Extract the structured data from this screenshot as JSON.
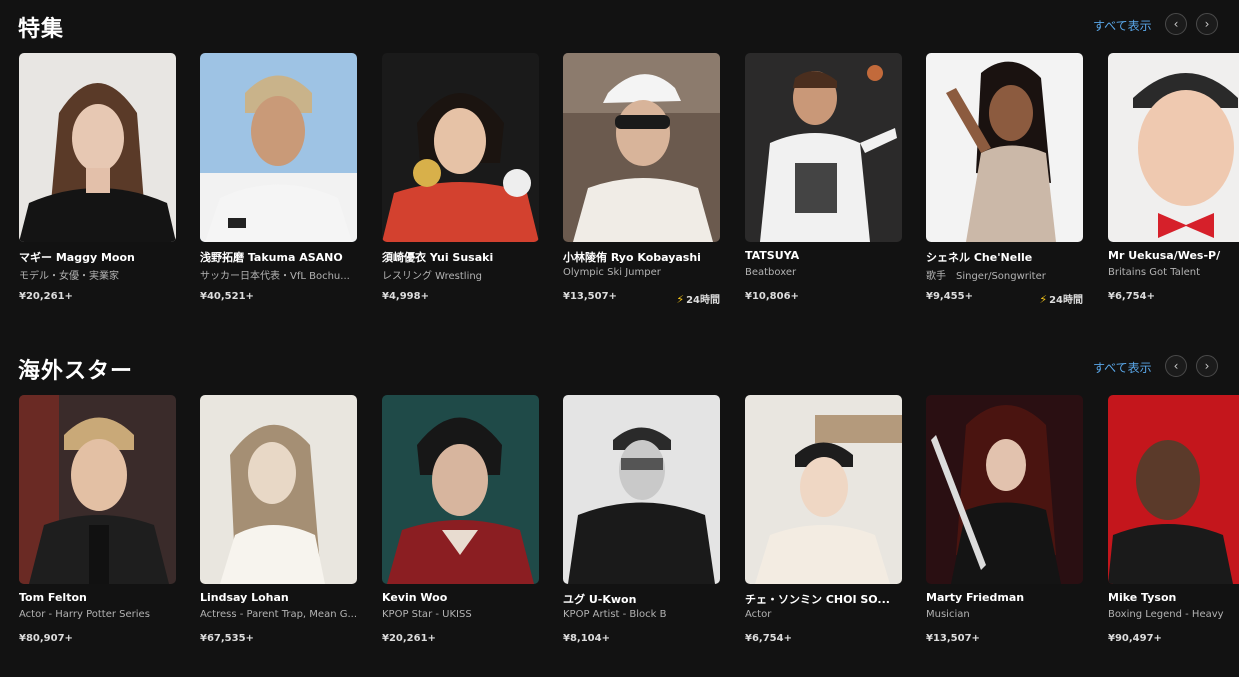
{
  "featured": {
    "title": "特集",
    "see_all": "すべて表示",
    "prev_icon": "chevron-left",
    "next_icon": "chevron-right",
    "cards": [
      {
        "name": "マギー Maggy Moon",
        "subtitle": "モデル・女優・実業家",
        "price": "¥20,261+"
      },
      {
        "name": "浅野拓磨 Takuma ASANO",
        "subtitle": "サッカー日本代表・VfL Bochu...",
        "price": "¥40,521+"
      },
      {
        "name": "須崎優衣 Yui Susaki",
        "subtitle": "レスリング Wrestling",
        "price": "¥4,998+"
      },
      {
        "name": "小林陵侑 Ryo Kobayashi",
        "subtitle": "Olympic Ski Jumper",
        "price": "¥13,507+",
        "badge": "24時間"
      },
      {
        "name": "TATSUYA",
        "subtitle": "Beatboxer",
        "price": "¥10,806+"
      },
      {
        "name": "シェネル Che'Nelle",
        "subtitle": "歌手　Singer/Songwriter",
        "price": "¥9,455+",
        "badge": "24時間"
      },
      {
        "name": "Mr Uekusa/Wes-P/",
        "subtitle": "Britains Got Talent",
        "price": "¥6,754+"
      }
    ]
  },
  "overseas": {
    "title": "海外スター",
    "see_all": "すべて表示",
    "prev_icon": "chevron-left",
    "next_icon": "chevron-right",
    "cards": [
      {
        "name": "Tom Felton",
        "subtitle": "Actor - Harry Potter Series",
        "price": "¥80,907+"
      },
      {
        "name": "Lindsay Lohan",
        "subtitle": "Actress - Parent Trap, Mean G...",
        "price": "¥67,535+"
      },
      {
        "name": "Kevin Woo",
        "subtitle": "KPOP Star - UKISS",
        "price": "¥20,261+"
      },
      {
        "name": "ユグ U-Kwon",
        "subtitle": "KPOP Artist - Block B",
        "price": "¥8,104+"
      },
      {
        "name": "チェ・ソンミン CHOI SO...",
        "subtitle": "Actor",
        "price": "¥6,754+"
      },
      {
        "name": "Marty Friedman",
        "subtitle": "Musician",
        "price": "¥13,507+"
      },
      {
        "name": "Mike Tyson",
        "subtitle": "Boxing Legend - Heavy",
        "price": "¥90,497+"
      }
    ]
  }
}
